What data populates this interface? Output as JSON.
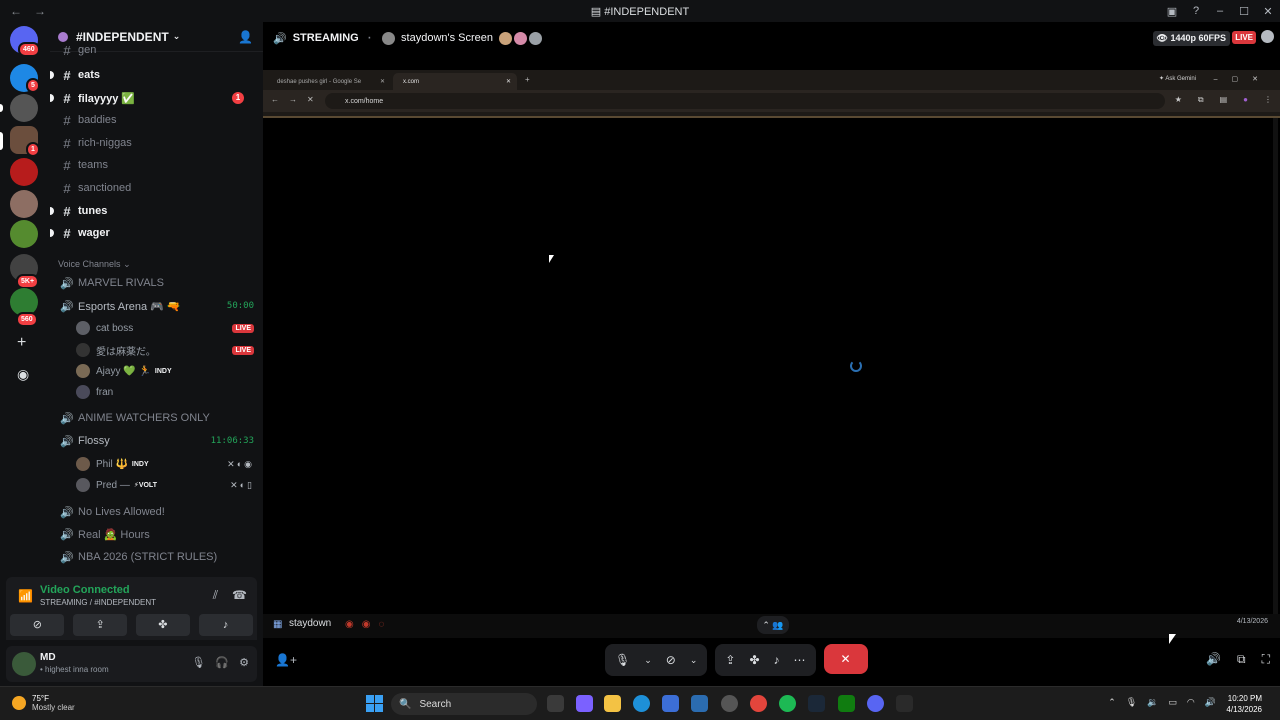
{
  "window": {
    "title": "#INDEPENDENT"
  },
  "server": {
    "name": "#INDEPENDENT"
  },
  "rail": {
    "badges": [
      "460",
      "5",
      "1",
      "5K+",
      "560"
    ]
  },
  "channels": [
    {
      "name": "gen",
      "unread": false
    },
    {
      "name": "eats",
      "unread": true
    },
    {
      "name": "filayyyy ✅",
      "unread": true,
      "mention": "1"
    },
    {
      "name": "baddies",
      "unread": false
    },
    {
      "name": "rich-niggas",
      "unread": false
    },
    {
      "name": "teams",
      "unread": false
    },
    {
      "name": "sanctioned",
      "unread": false
    },
    {
      "name": "tunes",
      "unread": true
    },
    {
      "name": "wager",
      "unread": true
    }
  ],
  "voice": {
    "category": "Voice Channels",
    "channels": [
      {
        "name": "MARVEL RIVALS"
      },
      {
        "name": "Esports Arena 🎮 🔫",
        "timer": "50:00",
        "users": [
          {
            "name": "cat boss",
            "live": "LIVE"
          },
          {
            "name": "愛は麻薬だ。",
            "live": "LIVE"
          },
          {
            "name": "Ajayy 💚 🏃",
            "tag": "INDY"
          },
          {
            "name": "fran"
          }
        ]
      },
      {
        "name": "ANIME WATCHERS ONLY"
      },
      {
        "name": "Flossy",
        "timer": "11:06:33",
        "users": [
          {
            "name": "Phil 🔱",
            "tag": "INDY"
          },
          {
            "name": "Pred —",
            "tag": "⚡VOLT"
          }
        ]
      },
      {
        "name": "No Lives Allowed!"
      },
      {
        "name": "Real 🧟 Hours"
      },
      {
        "name": "NBA 2026 (STRICT RULES)"
      }
    ]
  },
  "connection": {
    "status": "Video Connected",
    "sub": "STREAMING / #INDEPENDENT"
  },
  "user": {
    "name": "MD",
    "status": "• highest inna room"
  },
  "stream": {
    "title": "STREAMING",
    "screen": "staydown's Screen",
    "quality": "1440p 60FPS",
    "live": "LIVE",
    "browser": {
      "tab1": "deshae pushes girl - Google Se",
      "tab2": "x.com",
      "url": "x.com/home",
      "gemini": "Ask Gemini"
    },
    "inner_task_label": "staydown",
    "inner_date": "4/13/2026"
  },
  "taskbar": {
    "temp": "75°F",
    "weather": "Mostly clear",
    "search": "Search",
    "time": "10:20 PM",
    "date": "4/13/2026"
  },
  "colors": {
    "accent_red": "#da373c",
    "online_green": "#23a55a",
    "bg": "#111214"
  }
}
